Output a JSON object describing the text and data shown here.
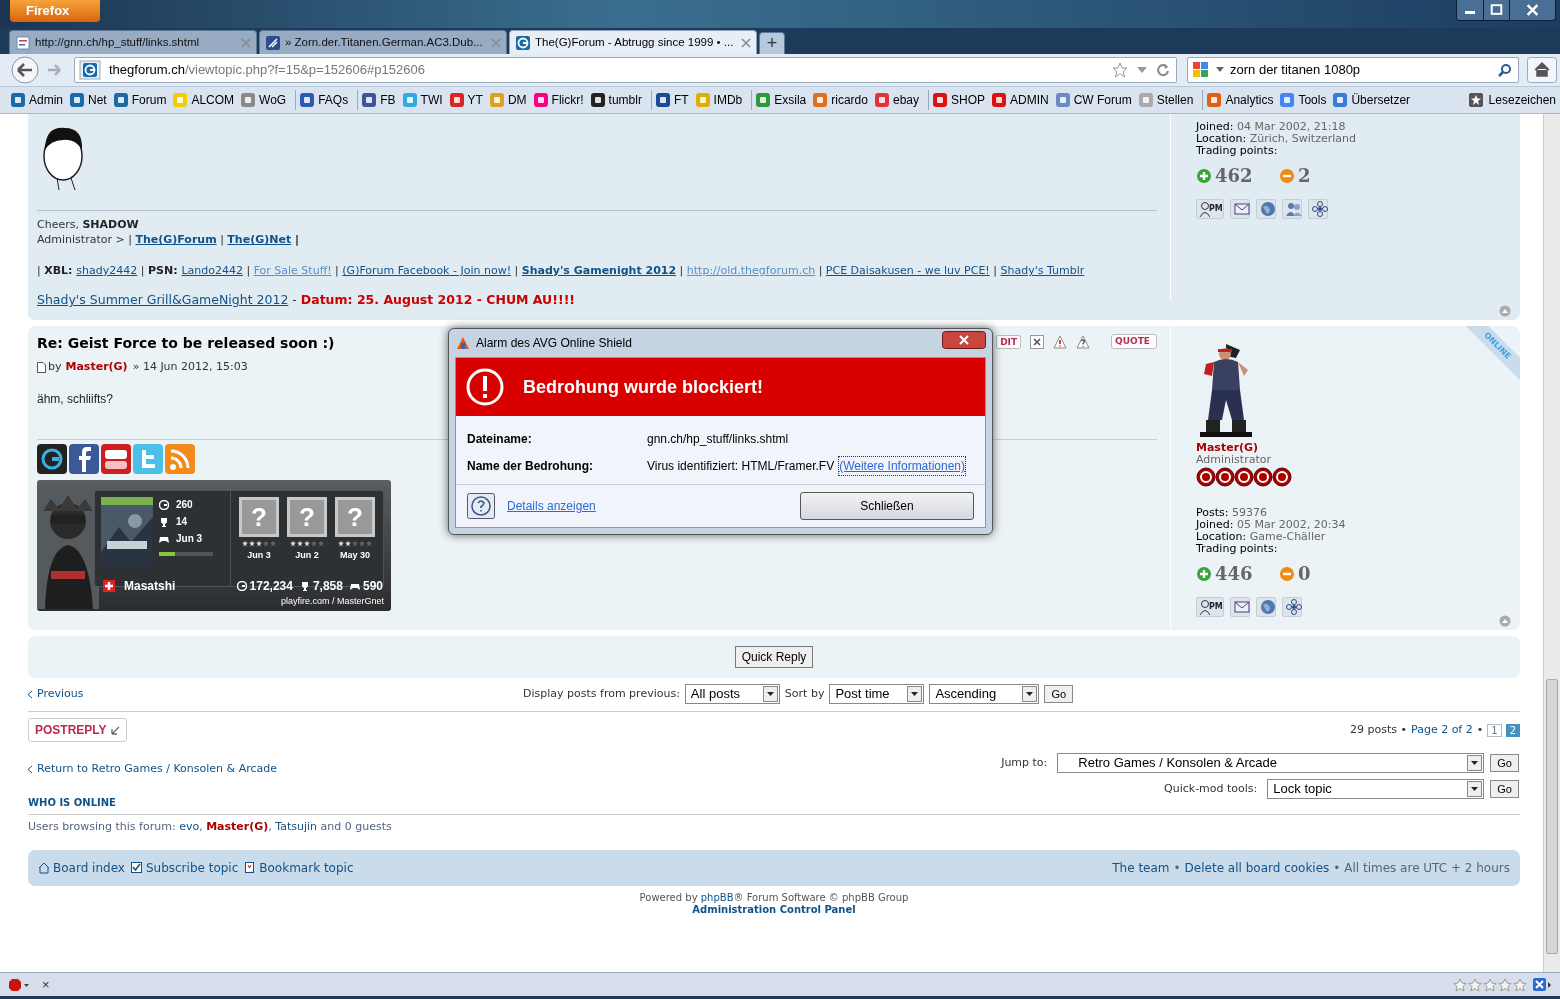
{
  "browser": {
    "menu_button": "Firefox",
    "tabs": [
      {
        "title": "http://gnn.ch/hp_stuff/links.shtml",
        "selected": false
      },
      {
        "title": "» Zorn.der.Titanen.German.AC3.Dub...",
        "selected": false
      },
      {
        "title": "The(G)Forum - Abtrugg since 1999 • ...",
        "selected": true
      }
    ],
    "new_tab": "+",
    "address": {
      "domain": "thegforum.ch",
      "path": "/viewtopic.php?f=15&p=152606#p152606"
    },
    "search": {
      "value": "zorn der titanen 1080p"
    },
    "bookmark_groups": [
      [
        {
          "label": "Admin",
          "color": "#1a6aa8"
        },
        {
          "label": "Net",
          "color": "#1a6aa8"
        },
        {
          "label": "Forum",
          "color": "#1a6aa8"
        },
        {
          "label": "ALCOM",
          "color": "#f0d000"
        },
        {
          "label": "WoG",
          "color": "#8a8a8a"
        }
      ],
      [
        {
          "label": "FAQs",
          "color": "#2a5ab8"
        }
      ],
      [
        {
          "label": "FB",
          "color": "#3b5998"
        },
        {
          "label": "TWI",
          "color": "#33aadd"
        },
        {
          "label": "YT",
          "color": "#dd2222"
        },
        {
          "label": "DM",
          "color": "#e0a020"
        },
        {
          "label": "Flickr!",
          "color": "#ff0084"
        },
        {
          "label": "tumblr",
          "color": "#222222"
        }
      ],
      [
        {
          "label": "FT",
          "color": "#1a4a9a"
        },
        {
          "label": "IMDb",
          "color": "#e0b000"
        }
      ],
      [
        {
          "label": "Exsila",
          "color": "#2a9a3a"
        },
        {
          "label": "ricardo",
          "color": "#e07020"
        },
        {
          "label": "ebay",
          "color": "#e53238"
        }
      ],
      [
        {
          "label": "SHOP",
          "color": "#dd1111"
        },
        {
          "label": "ADMIN",
          "color": "#dd1111"
        },
        {
          "label": "CW Forum",
          "color": "#6a8ac0"
        },
        {
          "label": "Stellen",
          "color": "#aaaaaa"
        }
      ],
      [
        {
          "label": "Analytics",
          "color": "#e06010"
        },
        {
          "label": "Tools",
          "color": "#4285f4"
        },
        {
          "label": "Übersetzer",
          "color": "#3a7ad8"
        }
      ]
    ],
    "bookmarks_menu": "Lesezeichen"
  },
  "post_1": {
    "signature": [
      [
        {
          "text": "Cheers, ",
          "kind": "plain"
        },
        {
          "text": "SHADOW",
          "kind": "bold"
        }
      ],
      [
        {
          "text": "Administrator > | ",
          "kind": "plain"
        },
        {
          "text": "The(G)Forum",
          "kind": "boldlink"
        },
        {
          "text": " | ",
          "kind": "plain"
        },
        {
          "text": "The(G)Net",
          "kind": "boldlink"
        },
        {
          "text": " |",
          "kind": "bold"
        }
      ],
      [
        {
          "text": "| ",
          "kind": "plain"
        },
        {
          "text": "XBL: ",
          "kind": "bold"
        },
        {
          "text": "shady2442",
          "kind": "link"
        },
        {
          "text": " | ",
          "kind": "plain"
        },
        {
          "text": "PSN: ",
          "kind": "bold"
        },
        {
          "text": "Lando2442",
          "kind": "link"
        },
        {
          "text": " | ",
          "kind": "plain"
        },
        {
          "text": "For Sale Stuff!",
          "kind": "lightlink"
        },
        {
          "text": " | ",
          "kind": "plain"
        },
        {
          "text": "(G)Forum Facebook - Join now!",
          "kind": "link"
        },
        {
          "text": " | ",
          "kind": "plain"
        },
        {
          "text": "Shady's Gamenight 2012",
          "kind": "boldlink"
        },
        {
          "text": " | ",
          "kind": "plain"
        },
        {
          "text": "http://old.thegforum.ch",
          "kind": "lightlink"
        },
        {
          "text": " | ",
          "kind": "plain"
        },
        {
          "text": "PCE Daisakusen - we luv PCE!",
          "kind": "link"
        },
        {
          "text": " | ",
          "kind": "plain"
        },
        {
          "text": "Shady's Tumblr",
          "kind": "link"
        }
      ],
      [
        {
          "text": "Shady's Summer Grill&GameNight 2012",
          "kind": "biglink"
        },
        {
          "text": " - ",
          "kind": "bigplain"
        },
        {
          "text": "Datum: 25. August 2012 - CHUM AU!!!!",
          "kind": "alert"
        }
      ]
    ],
    "profile": {
      "fields": [
        {
          "label": "Joined:",
          "value": "04 Mar 2002, 21:18"
        },
        {
          "label": "Location:",
          "value": "Zürich, Switzerland"
        }
      ],
      "trading_label": "Trading points:",
      "plus": "462",
      "minus": "2",
      "buttons": [
        {
          "kind": "pm",
          "label": "PM"
        },
        {
          "kind": "email"
        },
        {
          "kind": "web"
        },
        {
          "kind": "people"
        },
        {
          "kind": "flower"
        }
      ]
    }
  },
  "post_2": {
    "title": "Re: Geist Force to be released soon :)",
    "by": "by",
    "author": "Master(G)",
    "date": "» 14 Jun 2012, 15:03",
    "body": "ähm, schliifts?",
    "actions": [
      {
        "kind": "text",
        "label": "DIT"
      },
      {
        "kind": "delete"
      },
      {
        "kind": "warn"
      },
      {
        "kind": "info"
      },
      {
        "kind": "quote",
        "label": "QUOTE"
      }
    ],
    "socials": [
      {
        "kind": "g"
      },
      {
        "kind": "facebook"
      },
      {
        "kind": "youtube"
      },
      {
        "kind": "twitter"
      },
      {
        "kind": "rss"
      }
    ],
    "playfire": {
      "score": "260",
      "trophies": "14",
      "last_played": "Jun 3",
      "level": 0.3,
      "games": [
        {
          "tile": "?",
          "stars": 3,
          "date": "Jun 3"
        },
        {
          "tile": "?",
          "stars": 3,
          "date": "Jun 2"
        },
        {
          "tile": "?",
          "stars": 2,
          "date": "May 30"
        }
      ],
      "name": "Masatshi",
      "total_score": "172,234",
      "total_trophies": "7,858",
      "total_games": "590",
      "footer": "playfire.com / MasterGnet"
    },
    "online": "ONLINE",
    "profile": {
      "name": "Master(G)",
      "rank": "Administrator",
      "fields": [
        {
          "label": "Posts:",
          "value": "59376"
        },
        {
          "label": "Joined:",
          "value": "05 Mar 2002, 20:34"
        },
        {
          "label": "Location:",
          "value": "Game-Chäller"
        }
      ],
      "trading_label": "Trading points:",
      "plus": "446",
      "minus": "0",
      "buttons": [
        {
          "kind": "pm",
          "label": "PM"
        },
        {
          "kind": "email"
        },
        {
          "kind": "web"
        },
        {
          "kind": "flower"
        }
      ]
    }
  },
  "dialog": {
    "title": "Alarm des AVG Online Shield",
    "heading": "Bedrohung wurde blockiert!",
    "rows": [
      {
        "label": "Dateiname:",
        "value": "gnn.ch/hp_stuff/links.shtml"
      },
      {
        "label": "Name der Bedrohung:",
        "value": "Virus identifiziert: HTML/Framer.FV",
        "link": "(Weitere Informationen)"
      }
    ],
    "details": "Details anzeigen",
    "close_button": "Schließen"
  },
  "quick_reply": "Quick Reply",
  "previous": "Previous",
  "display_label": "Display posts from previous:",
  "display_value": "All posts",
  "sort_label": "Sort by",
  "sort_value": "Post time",
  "order_value": "Ascending",
  "go": "Go",
  "post_reply": "POSTREPLY",
  "pagination": {
    "count": "29 posts •",
    "page": "Page 2 of 2",
    "sep": "•",
    "pages": [
      {
        "label": "1",
        "selected": false
      },
      {
        "label": "2",
        "selected": true
      }
    ]
  },
  "return_link": "Return to Retro Games / Konsolen & Arcade",
  "jump_label": "Jump to:",
  "jump_value": "Retro Games / Konsolen & Arcade",
  "jump_go": "Go",
  "mod_label": "Quick-mod tools:",
  "mod_value": "Lock topic",
  "mod_go": "Go",
  "who_heading": "WHO IS ONLINE",
  "who": [
    {
      "text": "Users browsing this forum: ",
      "kind": "plain"
    },
    {
      "text": "evo",
      "kind": "user"
    },
    {
      "text": ", ",
      "kind": "plain"
    },
    {
      "text": "Master(G)",
      "kind": "admin"
    },
    {
      "text": ", ",
      "kind": "plain"
    },
    {
      "text": "Tatsujin",
      "kind": "user"
    },
    {
      "text": " and 0 guests",
      "kind": "plain"
    }
  ],
  "footer_left": [
    {
      "label": "Board index",
      "kind": "home"
    },
    {
      "label": "Subscribe topic",
      "kind": "check"
    },
    {
      "label": "Bookmark topic",
      "kind": "bookmark"
    }
  ],
  "footer_right": {
    "links": [
      "The team",
      "Delete all board cookies"
    ],
    "separator": "•",
    "note": "• All times are UTC + 2 hours"
  },
  "powered": {
    "before": "Powered by ",
    "link": "phpBB",
    "after": "® Forum Software © phpBB Group",
    "acp": "Administration Control Panel"
  },
  "status_bar": {
    "close": "×"
  }
}
